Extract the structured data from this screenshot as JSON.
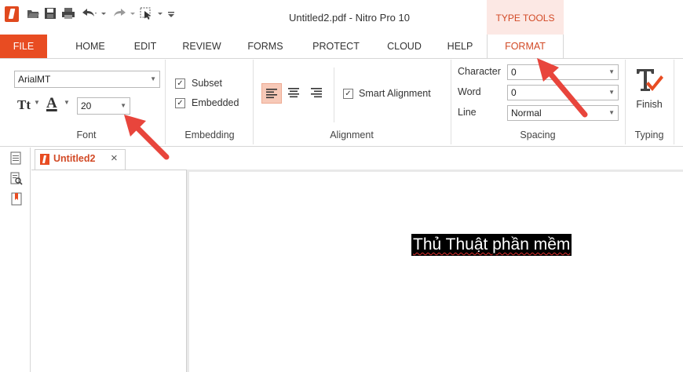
{
  "window": {
    "title": "Untitled2.pdf - Nitro Pro 10",
    "contextual_tab_label": "TYPE TOOLS"
  },
  "tabs": [
    {
      "label": "FILE"
    },
    {
      "label": "HOME"
    },
    {
      "label": "EDIT"
    },
    {
      "label": "REVIEW"
    },
    {
      "label": "FORMS"
    },
    {
      "label": "PROTECT"
    },
    {
      "label": "CLOUD"
    },
    {
      "label": "HELP"
    },
    {
      "label": "FORMAT"
    }
  ],
  "font_group": {
    "label": "Font",
    "font_name": "ArialMT",
    "font_size": "20",
    "text_size_icon": "Tt",
    "font_color_icon": "A"
  },
  "embedding_group": {
    "label": "Embedding",
    "subset_label": "Subset",
    "embedded_label": "Embedded",
    "subset_checked": true,
    "embedded_checked": true
  },
  "alignment_group": {
    "label": "Alignment",
    "smart_alignment_label": "Smart Alignment",
    "smart_alignment_checked": true
  },
  "spacing_group": {
    "label": "Spacing",
    "character_label": "Character",
    "character_value": "0",
    "word_label": "Word",
    "word_value": "0",
    "line_label": "Line",
    "line_value": "Normal"
  },
  "typing_group": {
    "label": "Typing",
    "finish_label": "Finish"
  },
  "document": {
    "tab_label": "Untitled2",
    "selected_text": "Thủ Thuật phần mềm"
  },
  "colors": {
    "accent": "#e84c22",
    "contextual_bg": "#fce8e4",
    "arrow": "#e8453c"
  }
}
